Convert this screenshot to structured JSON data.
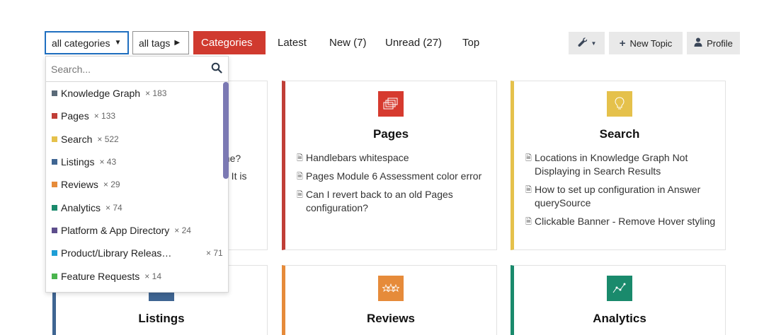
{
  "nav": {
    "category_dropdown": "all categories",
    "tags_dropdown": "all tags",
    "tabs": [
      {
        "label": "Categories"
      },
      {
        "label": "Latest"
      },
      {
        "label": "New (7)"
      },
      {
        "label": "Unread (27)"
      },
      {
        "label": "Top"
      }
    ],
    "new_topic": "New Topic",
    "profile": "Profile"
  },
  "category_menu": {
    "search_placeholder": "Search...",
    "items": [
      {
        "label": "Knowledge Graph",
        "count": "× 183",
        "color": "#5a6a78"
      },
      {
        "label": "Pages",
        "count": "× 133",
        "color": "#c03e37"
      },
      {
        "label": "Search",
        "count": "× 522",
        "color": "#e5c14b"
      },
      {
        "label": "Listings",
        "count": "× 43",
        "color": "#3f6592"
      },
      {
        "label": "Reviews",
        "count": "× 29",
        "color": "#e68b3a"
      },
      {
        "label": "Analytics",
        "count": "× 74",
        "color": "#1a8a6c"
      },
      {
        "label": "Platform & App Directory",
        "count": "× 24",
        "color": "#5d4e8c"
      },
      {
        "label": "Product/Library Releases & ...",
        "count": "× 71",
        "color": "#1e9ed6"
      },
      {
        "label": "Feature Requests",
        "count": "× 14",
        "color": "#4ab54e"
      }
    ]
  },
  "cards": {
    "left_top": {
      "peek1": "one?",
      "peek2": "? It is"
    },
    "pages": {
      "title": "Pages",
      "color": "#d63a2f",
      "topics": [
        "Handlebars whitespace",
        "Pages Module 6 Assessment color error",
        "Can I revert back to an old Pages configuration?"
      ]
    },
    "search": {
      "title": "Search",
      "color": "#e5c14b",
      "topics": [
        "Locations in Knowledge Graph Not Displaying in Search Results",
        "How to set up configuration in Answer querySource",
        "Clickable Banner - Remove Hover styling"
      ]
    },
    "listings": {
      "title": "Listings",
      "color": "#3f6592"
    },
    "reviews": {
      "title": "Reviews",
      "color": "#e68b3a"
    },
    "analytics": {
      "title": "Analytics",
      "color": "#1a8a6c"
    }
  }
}
